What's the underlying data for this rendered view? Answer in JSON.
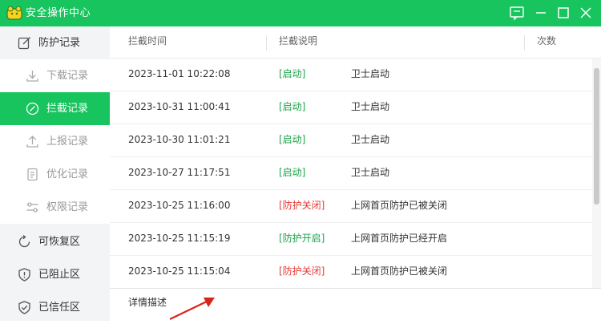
{
  "window": {
    "title": "安全操作中心"
  },
  "colors": {
    "brand": "#17c45d",
    "tag_green": "#1aa34a",
    "tag_red": "#e53935"
  },
  "icons": {
    "logo": "app-logo-icon",
    "feedback": "feedback-icon",
    "minimize": "minimize-icon",
    "maximize": "maximize-icon",
    "close": "close-icon"
  },
  "sidebar": {
    "items": [
      {
        "label": "防护记录",
        "icon": "edit-icon",
        "type": "group"
      },
      {
        "label": "下载记录",
        "icon": "download-icon",
        "type": "sub"
      },
      {
        "label": "拦截记录",
        "icon": "block-icon",
        "type": "sub-active"
      },
      {
        "label": "上报记录",
        "icon": "upload-icon",
        "type": "sub"
      },
      {
        "label": "优化记录",
        "icon": "document-icon",
        "type": "sub"
      },
      {
        "label": "权限记录",
        "icon": "sliders-icon",
        "type": "sub"
      },
      {
        "label": "可恢复区",
        "icon": "restore-icon",
        "type": "group"
      },
      {
        "label": "已阻止区",
        "icon": "shield-alert-icon",
        "type": "group"
      },
      {
        "label": "已信任区",
        "icon": "shield-check-icon",
        "type": "group"
      }
    ]
  },
  "table": {
    "columns": {
      "time": "拦截时间",
      "desc": "拦截说明",
      "count": "次数"
    },
    "rows": [
      {
        "time": "2023-11-01 10:22:08",
        "tag": "[启动]",
        "tag_color": "green",
        "desc": "卫士启动"
      },
      {
        "time": "2023-10-31 11:00:41",
        "tag": "[启动]",
        "tag_color": "green",
        "desc": "卫士启动"
      },
      {
        "time": "2023-10-30 11:01:21",
        "tag": "[启动]",
        "tag_color": "green",
        "desc": "卫士启动"
      },
      {
        "time": "2023-10-27 11:17:51",
        "tag": "[启动]",
        "tag_color": "green",
        "desc": "卫士启动"
      },
      {
        "time": "2023-10-25 11:16:00",
        "tag": "[防护关闭]",
        "tag_color": "red",
        "desc": "上网首页防护已被关闭"
      },
      {
        "time": "2023-10-25 11:15:19",
        "tag": "[防护开启]",
        "tag_color": "green",
        "desc": "上网首页防护已经开启"
      },
      {
        "time": "2023-10-25 11:15:04",
        "tag": "[防护关闭]",
        "tag_color": "red",
        "desc": "上网首页防护已被关闭"
      }
    ]
  },
  "detail": {
    "label": "详情描述"
  }
}
